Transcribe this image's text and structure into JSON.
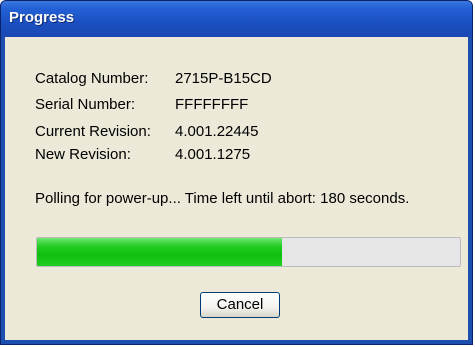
{
  "window": {
    "title": "Progress"
  },
  "info": {
    "catalog_label": "Catalog Number:",
    "catalog_value": "2715P-B15CD",
    "serial_label": "Serial Number:",
    "serial_value": "FFFFFFFF",
    "current_rev_label": "Current Revision:",
    "current_rev_value": "4.001.22445",
    "new_rev_label": "New Revision:",
    "new_rev_value": "4.001.1275"
  },
  "status_text": "Polling for power-up... Time left until abort: 180 seconds.",
  "progress": {
    "percent": 58,
    "fill_color": "#1fcb1f"
  },
  "buttons": {
    "cancel_label": "Cancel"
  },
  "colors": {
    "titlebar": "#1b50c2",
    "client_bg": "#ece9d8"
  }
}
